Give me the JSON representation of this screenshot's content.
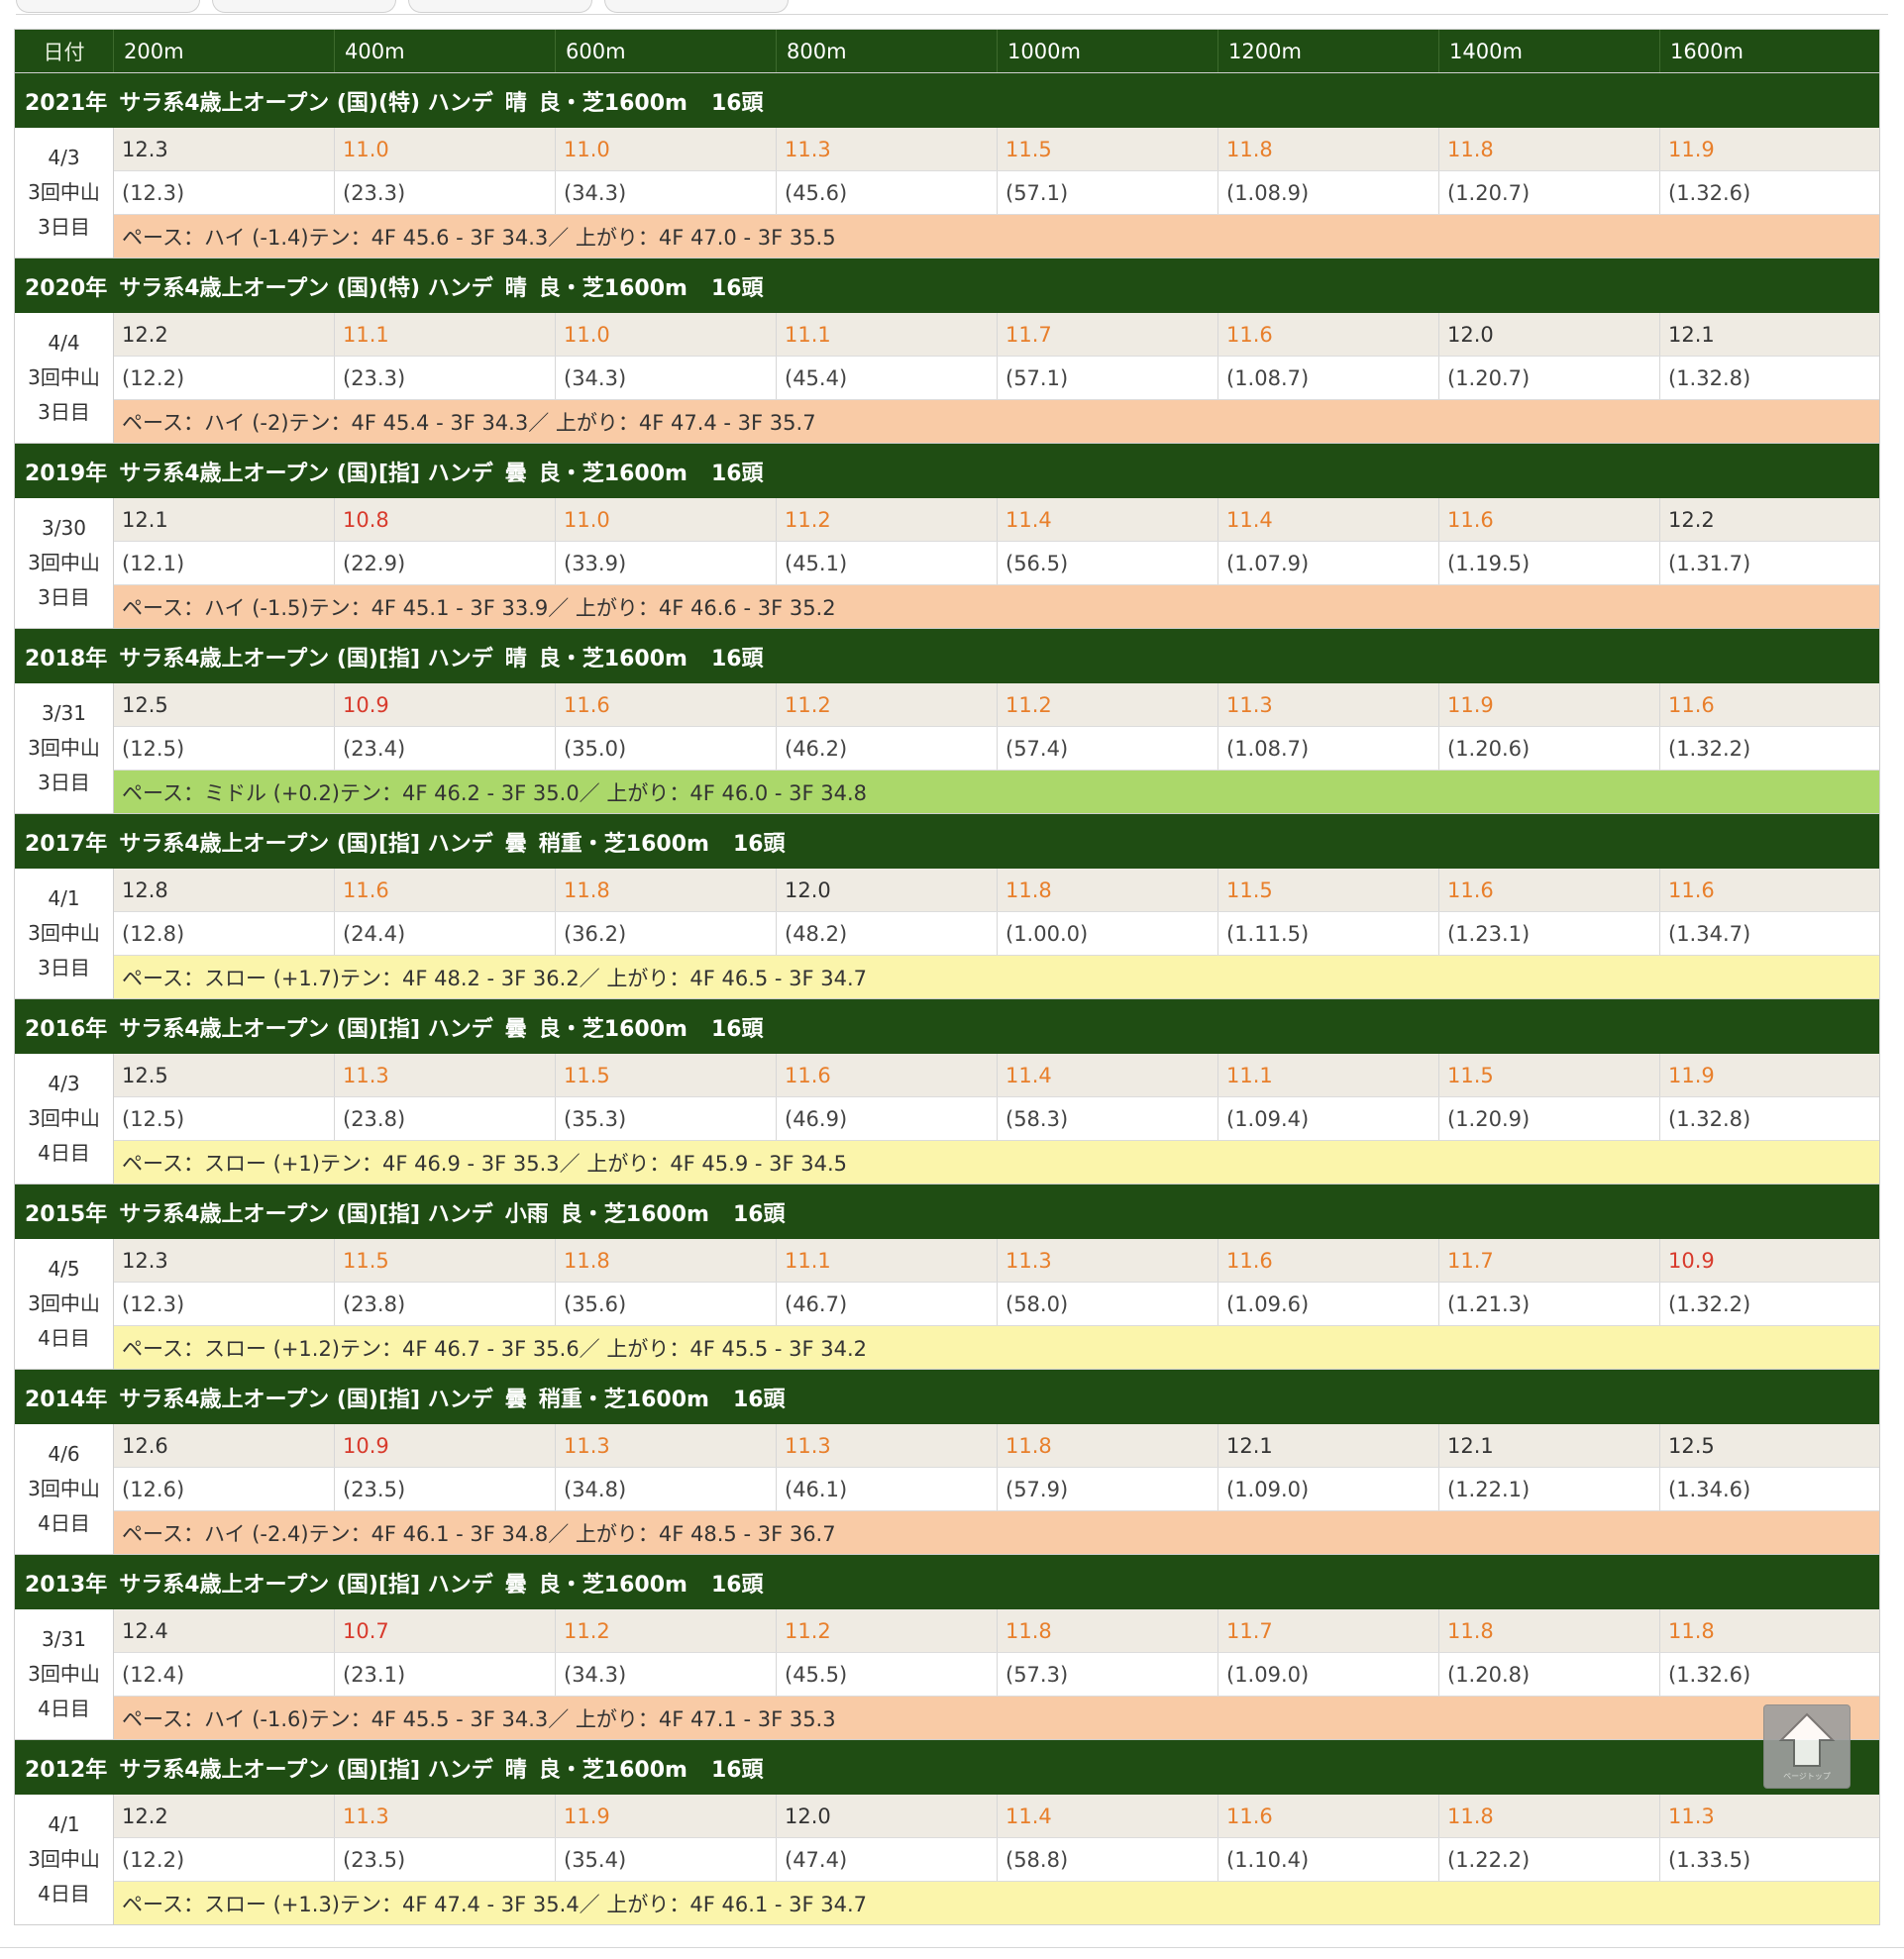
{
  "header": {
    "date": "日付",
    "distances": [
      "200m",
      "400m",
      "600m",
      "800m",
      "1000m",
      "1200m",
      "1400m",
      "1600m"
    ]
  },
  "colors": {
    "lap_fast": "#e87f2b",
    "lap_very_fast": "#d83a2c",
    "lap_normal": "#333333"
  },
  "races": [
    {
      "year": "2021年",
      "info": "サラ系4歳上オープン (国)(特) ハンデ",
      "weather": "晴",
      "track": "良・芝1600m",
      "runners": "16頭",
      "date": "4/3",
      "meeting": "3回中山",
      "day": "3日目",
      "laps": [
        {
          "v": "12.3",
          "c": "n"
        },
        {
          "v": "11.0",
          "c": "f"
        },
        {
          "v": "11.0",
          "c": "f"
        },
        {
          "v": "11.3",
          "c": "f"
        },
        {
          "v": "11.5",
          "c": "f"
        },
        {
          "v": "11.8",
          "c": "f"
        },
        {
          "v": "11.8",
          "c": "f"
        },
        {
          "v": "11.9",
          "c": "f"
        }
      ],
      "cum": [
        "(12.3)",
        "(23.3)",
        "(34.3)",
        "(45.6)",
        "(57.1)",
        "(1.08.9)",
        "(1.20.7)",
        "(1.32.6)"
      ],
      "pace": "ペース：ハイ (-1.4)テン：4F 45.6 - 3F 34.3／ 上がり：4F 47.0 - 3F 35.5",
      "pace_type": "hi"
    },
    {
      "year": "2020年",
      "info": "サラ系4歳上オープン (国)(特) ハンデ",
      "weather": "晴",
      "track": "良・芝1600m",
      "runners": "16頭",
      "date": "4/4",
      "meeting": "3回中山",
      "day": "3日目",
      "laps": [
        {
          "v": "12.2",
          "c": "n"
        },
        {
          "v": "11.1",
          "c": "f"
        },
        {
          "v": "11.0",
          "c": "f"
        },
        {
          "v": "11.1",
          "c": "f"
        },
        {
          "v": "11.7",
          "c": "f"
        },
        {
          "v": "11.6",
          "c": "f"
        },
        {
          "v": "12.0",
          "c": "n"
        },
        {
          "v": "12.1",
          "c": "n"
        }
      ],
      "cum": [
        "(12.2)",
        "(23.3)",
        "(34.3)",
        "(45.4)",
        "(57.1)",
        "(1.08.7)",
        "(1.20.7)",
        "(1.32.8)"
      ],
      "pace": "ペース：ハイ (-2)テン：4F 45.4 - 3F 34.3／ 上がり：4F 47.4 - 3F 35.7",
      "pace_type": "hi"
    },
    {
      "year": "2019年",
      "info": "サラ系4歳上オープン (国)[指] ハンデ",
      "weather": "曇",
      "track": "良・芝1600m",
      "runners": "16頭",
      "date": "3/30",
      "meeting": "3回中山",
      "day": "3日目",
      "laps": [
        {
          "v": "12.1",
          "c": "n"
        },
        {
          "v": "10.8",
          "c": "r"
        },
        {
          "v": "11.0",
          "c": "f"
        },
        {
          "v": "11.2",
          "c": "f"
        },
        {
          "v": "11.4",
          "c": "f"
        },
        {
          "v": "11.4",
          "c": "f"
        },
        {
          "v": "11.6",
          "c": "f"
        },
        {
          "v": "12.2",
          "c": "n"
        }
      ],
      "cum": [
        "(12.1)",
        "(22.9)",
        "(33.9)",
        "(45.1)",
        "(56.5)",
        "(1.07.9)",
        "(1.19.5)",
        "(1.31.7)"
      ],
      "pace": "ペース：ハイ (-1.5)テン：4F 45.1 - 3F 33.9／ 上がり：4F 46.6 - 3F 35.2",
      "pace_type": "hi"
    },
    {
      "year": "2018年",
      "info": "サラ系4歳上オープン (国)[指] ハンデ",
      "weather": "晴",
      "track": "良・芝1600m",
      "runners": "16頭",
      "date": "3/31",
      "meeting": "3回中山",
      "day": "3日目",
      "laps": [
        {
          "v": "12.5",
          "c": "n"
        },
        {
          "v": "10.9",
          "c": "r"
        },
        {
          "v": "11.6",
          "c": "f"
        },
        {
          "v": "11.2",
          "c": "f"
        },
        {
          "v": "11.2",
          "c": "f"
        },
        {
          "v": "11.3",
          "c": "f"
        },
        {
          "v": "11.9",
          "c": "f"
        },
        {
          "v": "11.6",
          "c": "f"
        }
      ],
      "cum": [
        "(12.5)",
        "(23.4)",
        "(35.0)",
        "(46.2)",
        "(57.4)",
        "(1.08.7)",
        "(1.20.6)",
        "(1.32.2)"
      ],
      "pace": "ペース：ミドル (+0.2)テン：4F 46.2 - 3F 35.0／ 上がり：4F 46.0 - 3F 34.8",
      "pace_type": "mid"
    },
    {
      "year": "2017年",
      "info": "サラ系4歳上オープン (国)[指] ハンデ",
      "weather": "曇",
      "track": "稍重・芝1600m",
      "runners": "16頭",
      "date": "4/1",
      "meeting": "3回中山",
      "day": "3日目",
      "laps": [
        {
          "v": "12.8",
          "c": "n"
        },
        {
          "v": "11.6",
          "c": "f"
        },
        {
          "v": "11.8",
          "c": "f"
        },
        {
          "v": "12.0",
          "c": "n"
        },
        {
          "v": "11.8",
          "c": "f"
        },
        {
          "v": "11.5",
          "c": "f"
        },
        {
          "v": "11.6",
          "c": "f"
        },
        {
          "v": "11.6",
          "c": "f"
        }
      ],
      "cum": [
        "(12.8)",
        "(24.4)",
        "(36.2)",
        "(48.2)",
        "(1.00.0)",
        "(1.11.5)",
        "(1.23.1)",
        "(1.34.7)"
      ],
      "pace": "ペース：スロー (+1.7)テン：4F 48.2 - 3F 36.2／ 上がり：4F 46.5 - 3F 34.7",
      "pace_type": "slow"
    },
    {
      "year": "2016年",
      "info": "サラ系4歳上オープン (国)[指] ハンデ",
      "weather": "曇",
      "track": "良・芝1600m",
      "runners": "16頭",
      "date": "4/3",
      "meeting": "3回中山",
      "day": "4日目",
      "laps": [
        {
          "v": "12.5",
          "c": "n"
        },
        {
          "v": "11.3",
          "c": "f"
        },
        {
          "v": "11.5",
          "c": "f"
        },
        {
          "v": "11.6",
          "c": "f"
        },
        {
          "v": "11.4",
          "c": "f"
        },
        {
          "v": "11.1",
          "c": "f"
        },
        {
          "v": "11.5",
          "c": "f"
        },
        {
          "v": "11.9",
          "c": "f"
        }
      ],
      "cum": [
        "(12.5)",
        "(23.8)",
        "(35.3)",
        "(46.9)",
        "(58.3)",
        "(1.09.4)",
        "(1.20.9)",
        "(1.32.8)"
      ],
      "pace": "ペース：スロー (+1)テン：4F 46.9 - 3F 35.3／ 上がり：4F 45.9 - 3F 34.5",
      "pace_type": "slow"
    },
    {
      "year": "2015年",
      "info": "サラ系4歳上オープン (国)[指] ハンデ",
      "weather": "小雨",
      "track": "良・芝1600m",
      "runners": "16頭",
      "date": "4/5",
      "meeting": "3回中山",
      "day": "4日目",
      "laps": [
        {
          "v": "12.3",
          "c": "n"
        },
        {
          "v": "11.5",
          "c": "f"
        },
        {
          "v": "11.8",
          "c": "f"
        },
        {
          "v": "11.1",
          "c": "f"
        },
        {
          "v": "11.3",
          "c": "f"
        },
        {
          "v": "11.6",
          "c": "f"
        },
        {
          "v": "11.7",
          "c": "f"
        },
        {
          "v": "10.9",
          "c": "r"
        }
      ],
      "cum": [
        "(12.3)",
        "(23.8)",
        "(35.6)",
        "(46.7)",
        "(58.0)",
        "(1.09.6)",
        "(1.21.3)",
        "(1.32.2)"
      ],
      "pace": "ペース：スロー (+1.2)テン：4F 46.7 - 3F 35.6／ 上がり：4F 45.5 - 3F 34.2",
      "pace_type": "slow"
    },
    {
      "year": "2014年",
      "info": "サラ系4歳上オープン (国)[指] ハンデ",
      "weather": "曇",
      "track": "稍重・芝1600m",
      "runners": "16頭",
      "date": "4/6",
      "meeting": "3回中山",
      "day": "4日目",
      "laps": [
        {
          "v": "12.6",
          "c": "n"
        },
        {
          "v": "10.9",
          "c": "r"
        },
        {
          "v": "11.3",
          "c": "f"
        },
        {
          "v": "11.3",
          "c": "f"
        },
        {
          "v": "11.8",
          "c": "f"
        },
        {
          "v": "12.1",
          "c": "n"
        },
        {
          "v": "12.1",
          "c": "n"
        },
        {
          "v": "12.5",
          "c": "n"
        }
      ],
      "cum": [
        "(12.6)",
        "(23.5)",
        "(34.8)",
        "(46.1)",
        "(57.9)",
        "(1.09.0)",
        "(1.22.1)",
        "(1.34.6)"
      ],
      "pace": "ペース：ハイ (-2.4)テン：4F 46.1 - 3F 34.8／ 上がり：4F 48.5 - 3F 36.7",
      "pace_type": "hi"
    },
    {
      "year": "2013年",
      "info": "サラ系4歳上オープン (国)[指] ハンデ",
      "weather": "曇",
      "track": "良・芝1600m",
      "runners": "16頭",
      "date": "3/31",
      "meeting": "3回中山",
      "day": "4日目",
      "laps": [
        {
          "v": "12.4",
          "c": "n"
        },
        {
          "v": "10.7",
          "c": "r"
        },
        {
          "v": "11.2",
          "c": "f"
        },
        {
          "v": "11.2",
          "c": "f"
        },
        {
          "v": "11.8",
          "c": "f"
        },
        {
          "v": "11.7",
          "c": "f"
        },
        {
          "v": "11.8",
          "c": "f"
        },
        {
          "v": "11.8",
          "c": "f"
        }
      ],
      "cum": [
        "(12.4)",
        "(23.1)",
        "(34.3)",
        "(45.5)",
        "(57.3)",
        "(1.09.0)",
        "(1.20.8)",
        "(1.32.6)"
      ],
      "pace": "ペース：ハイ (-1.6)テン：4F 45.5 - 3F 34.3／ 上がり：4F 47.1 - 3F 35.3",
      "pace_type": "hi"
    },
    {
      "year": "2012年",
      "info": "サラ系4歳上オープン (国)[指] ハンデ",
      "weather": "晴",
      "track": "良・芝1600m",
      "runners": "16頭",
      "date": "4/1",
      "meeting": "3回中山",
      "day": "4日目",
      "laps": [
        {
          "v": "12.2",
          "c": "n"
        },
        {
          "v": "11.3",
          "c": "f"
        },
        {
          "v": "11.9",
          "c": "f"
        },
        {
          "v": "12.0",
          "c": "n"
        },
        {
          "v": "11.4",
          "c": "f"
        },
        {
          "v": "11.6",
          "c": "f"
        },
        {
          "v": "11.8",
          "c": "f"
        },
        {
          "v": "11.3",
          "c": "f"
        }
      ],
      "cum": [
        "(12.2)",
        "(23.5)",
        "(35.4)",
        "(47.4)",
        "(58.8)",
        "(1.10.4)",
        "(1.22.2)",
        "(1.33.5)"
      ],
      "pace": "ペース：スロー (+1.3)テン：4F 47.4 - 3F 35.4／ 上がり：4F 46.1 - 3F 34.7",
      "pace_type": "slow"
    }
  ],
  "page_top": {
    "label": "ページトップ",
    "icon": "arrow-up-icon"
  }
}
